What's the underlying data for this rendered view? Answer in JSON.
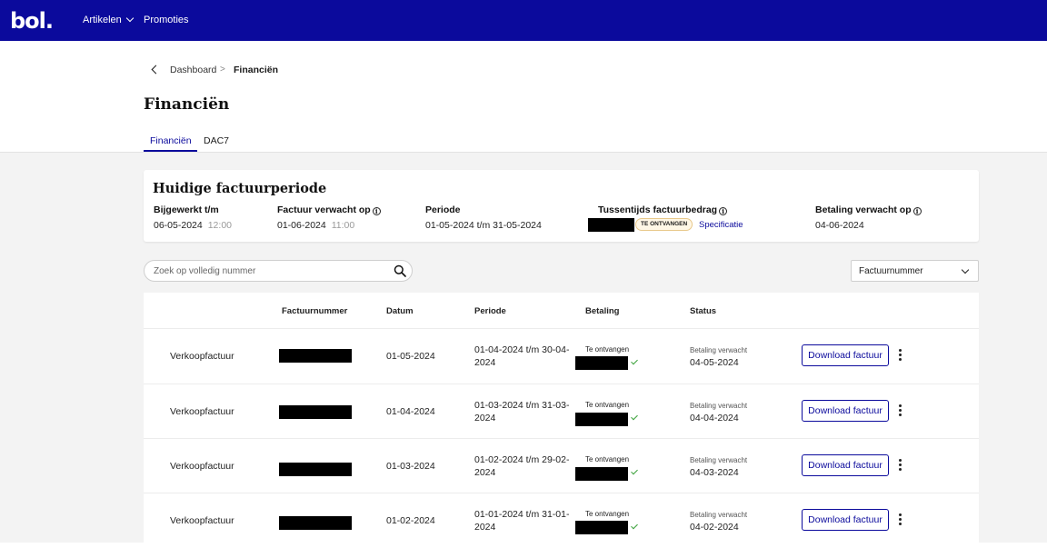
{
  "header": {
    "logo": "bol.",
    "nav": [
      {
        "label": "Artikelen"
      },
      {
        "label": "Promoties"
      }
    ]
  },
  "breadcrumb": {
    "parent": "Dashboard",
    "separator": ">",
    "current": "Financiën"
  },
  "page": {
    "title": "Financiën"
  },
  "tabs": [
    {
      "label": "Financiën",
      "active": true
    },
    {
      "label": "DAC7",
      "active": false
    }
  ],
  "period_card": {
    "title": "Huidige factuurperiode",
    "updated": {
      "label": "Bijgewerkt t/m",
      "date": "06-05-2024",
      "time": "12:00"
    },
    "invoice_expected": {
      "label": "Factuur verwacht op",
      "date": "01-06-2024",
      "time": "11:00"
    },
    "period": {
      "label": "Periode",
      "value": "01-05-2024 t/m 31-05-2024"
    },
    "interim_amount": {
      "label": "Tussentijds factuurbedrag",
      "badge": "TE ONTVANGEN",
      "link": "Specificatie"
    },
    "payment_expected": {
      "label": "Betaling verwacht op",
      "date": "04-06-2024"
    }
  },
  "search": {
    "placeholder": "Zoek op volledig nummer"
  },
  "sort": {
    "value": "Factuurnummer"
  },
  "table": {
    "headers": {
      "invoice_number": "Factuurnummer",
      "date": "Datum",
      "period": "Periode",
      "payment": "Betaling",
      "status": "Status"
    },
    "rows": [
      {
        "type": "Verkoopfactuur",
        "date": "01-05-2024",
        "period": "01-04-2024 t/m 30-04-2024",
        "payment_label": "Te ontvangen",
        "status_label": "Betaling verwacht",
        "status_date": "04-05-2024",
        "action": "Download factuur"
      },
      {
        "type": "Verkoopfactuur",
        "date": "01-04-2024",
        "period": "01-03-2024 t/m 31-03-2024",
        "payment_label": "Te ontvangen",
        "status_label": "Betaling verwacht",
        "status_date": "04-04-2024",
        "action": "Download factuur"
      },
      {
        "type": "Verkoopfactuur",
        "date": "01-03-2024",
        "period": "01-02-2024 t/m 29-02-2024",
        "payment_label": "Te ontvangen",
        "status_label": "Betaling verwacht",
        "status_date": "04-03-2024",
        "action": "Download factuur"
      },
      {
        "type": "Verkoopfactuur",
        "date": "01-02-2024",
        "period": "01-01-2024 t/m 31-01-2024",
        "payment_label": "Te ontvangen",
        "status_label": "Betaling verwacht",
        "status_date": "04-02-2024",
        "action": "Download factuur"
      }
    ]
  },
  "colors": {
    "brand": "#0b0a9c",
    "check": "#3aa13a",
    "badge_bg": "#fff7e6"
  }
}
